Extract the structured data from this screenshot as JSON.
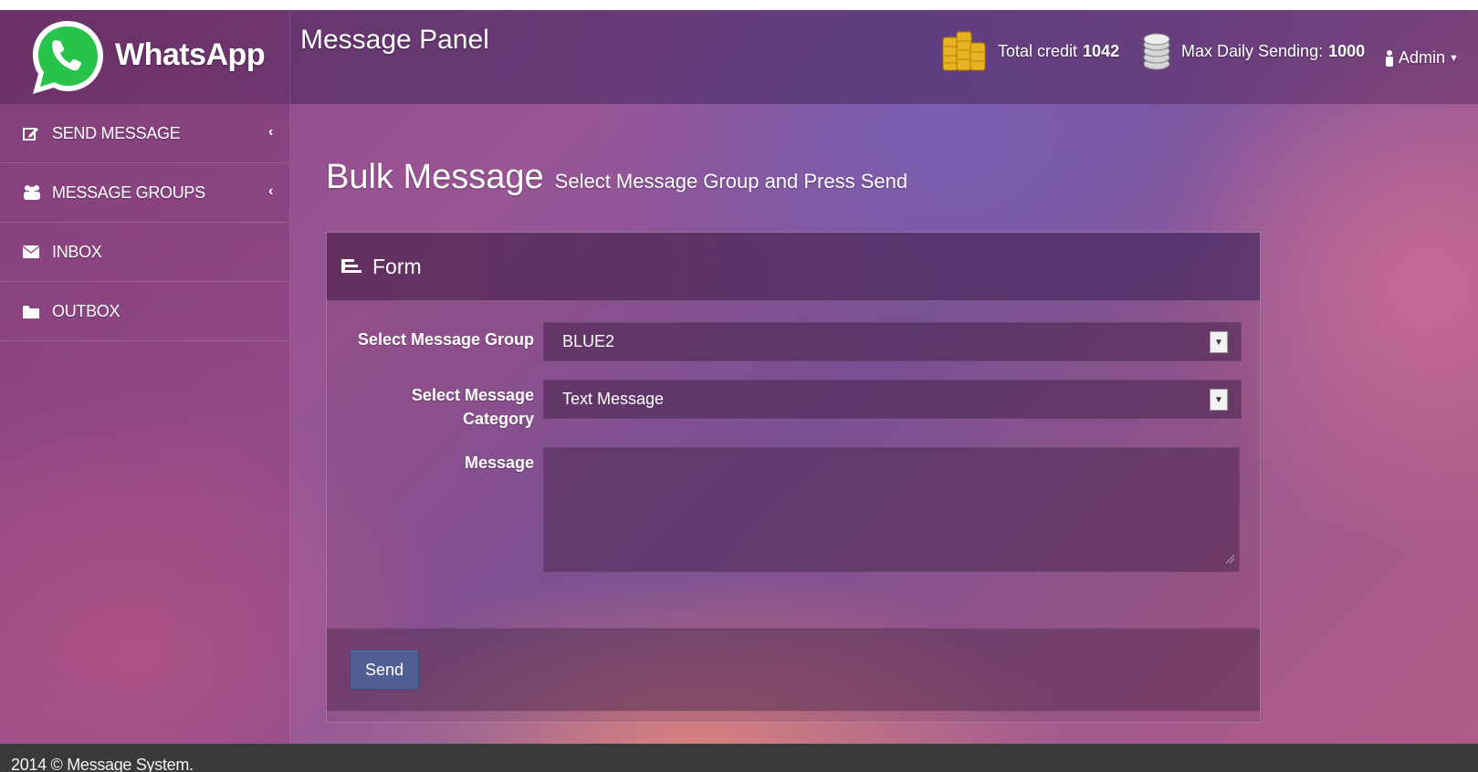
{
  "brand": {
    "name": "WhatsApp",
    "logo_icon": "whatsapp-logo-icon"
  },
  "header": {
    "panel_title": "Message Panel",
    "total_credit": {
      "label": "Total credit",
      "value": "1042",
      "icon": "gold-coins-icon"
    },
    "max_daily": {
      "label": "Max Daily Sending:",
      "value": "1000",
      "icon": "silver-coins-icon"
    },
    "user": {
      "label": "Admin",
      "icon": "user-icon"
    }
  },
  "sidebar": {
    "items": [
      {
        "label": "SEND MESSAGE",
        "icon": "edit-icon",
        "chevron": "‹"
      },
      {
        "label": "MESSAGE GROUPS",
        "icon": "users-icon",
        "chevron": "‹"
      },
      {
        "label": "INBOX",
        "icon": "envelope-icon"
      },
      {
        "label": "OUTBOX",
        "icon": "folder-icon"
      }
    ]
  },
  "page": {
    "title": "Bulk Message",
    "subtitle": "Select Message Group and Press Send"
  },
  "form": {
    "title": "Form",
    "icon": "list-icon",
    "group_label": "Select Message Group",
    "group_value": "BLUE2",
    "category_label_1": "Select Message",
    "category_label_2": "Category",
    "category_value": "Text Message",
    "message_label": "Message",
    "message_value": "",
    "send_label": "Send"
  },
  "footer": {
    "text": "2014 © Message System."
  },
  "colors": {
    "send_button": "#4f5f95",
    "footer_bg": "#3a3a3a",
    "whatsapp_green": "#27c34a"
  }
}
